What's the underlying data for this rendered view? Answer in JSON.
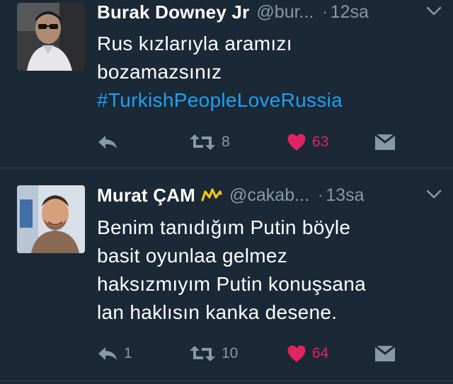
{
  "tweets": [
    {
      "display_name": "Burak Downey Jr",
      "handle": "@bur...",
      "separator": "·",
      "time": "12sa",
      "has_badge": false,
      "body_lines": [
        "Rus kızlarıyla aramızı",
        "bozamazsınız"
      ],
      "hashtag": "#TurkishPeopleLoveRussia",
      "reply_count": "",
      "retweet_count": "8",
      "like_count": "63",
      "liked": true,
      "avatar_icon": "profile-photo-sunglasses"
    },
    {
      "display_name": "Murat ÇAM",
      "handle": "@cakab...",
      "separator": "·",
      "time": "13sa",
      "has_badge": true,
      "badge_icon": "crown-icon",
      "body_lines": [
        "Benim tanıdığım Putin böyle",
        "basit oyunlaa gelmez",
        "haksızmıyım Putin konuşsana",
        "lan haklısın kanka desene."
      ],
      "hashtag": "",
      "reply_count": "1",
      "retweet_count": "10",
      "like_count": "64",
      "liked": true,
      "avatar_icon": "profile-photo-smiling"
    }
  ],
  "colors": {
    "background": "#1b2836",
    "text": "#ffffff",
    "secondary": "#8899a6",
    "link": "#1da1f2",
    "like": "#e0245e",
    "divider": "#38444d",
    "badge": "#f5c518"
  }
}
